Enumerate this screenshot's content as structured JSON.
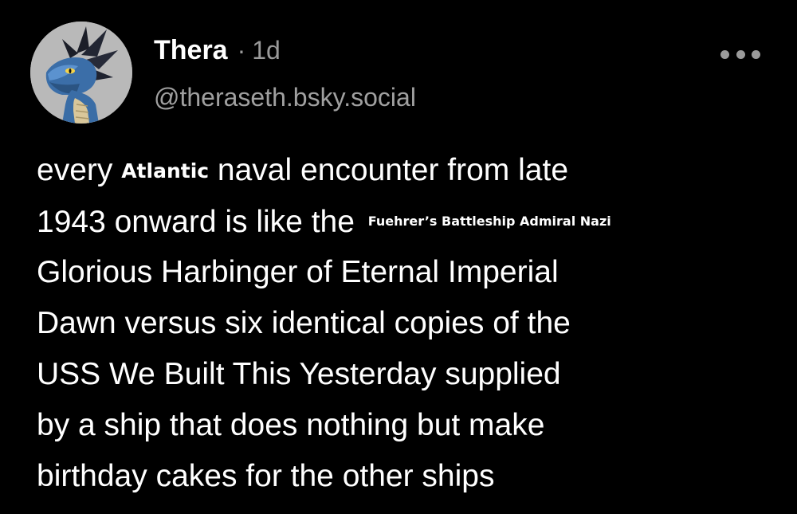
{
  "post": {
    "author": {
      "display_name": "Thera",
      "separator": "·",
      "timestamp": "1d",
      "handle": "@theraseth.bsky.social",
      "avatar_icon": "dragon-avatar"
    },
    "menu_icon": "more-horizontal-icon",
    "text_lines": {
      "l1_before": "every ",
      "l1_overlay": "Atlantic",
      "l1_after": " naval encounter from late",
      "l2_before": "1943 onward is like the ",
      "l2_overlay": "Fuehrer’s Battleship Admiral Nazi",
      "l3": "Glorious Harbinger of Eternal Imperial",
      "l4": "Dawn versus six identical copies of the",
      "l5": "USS We Built This Yesterday supplied",
      "l6": "by a ship that does nothing but make",
      "l7": "birthday cakes for the other ships"
    }
  },
  "colors": {
    "background": "#000000",
    "text": "#ffffff",
    "muted": "#9a9a9a"
  }
}
